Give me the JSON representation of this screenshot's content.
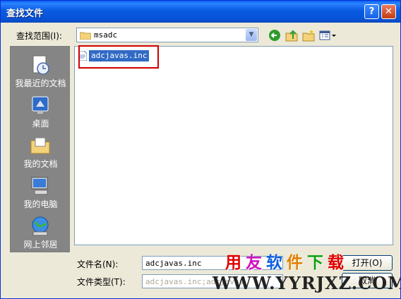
{
  "window": {
    "title": "查找文件",
    "help_label": "?",
    "close_label": "✕"
  },
  "toolbar": {
    "look_in_label": "查找范围(I):",
    "look_in_value": "msadc",
    "back_icon": "back-arrow-icon",
    "up_icon": "up-folder-icon",
    "new_folder_icon": "new-folder-icon",
    "view_icon": "view-menu-icon"
  },
  "places": [
    {
      "label": "我最近的文档",
      "icon": "recent-documents-icon"
    },
    {
      "label": "桌面",
      "icon": "desktop-icon"
    },
    {
      "label": "我的文档",
      "icon": "my-documents-icon"
    },
    {
      "label": "我的电脑",
      "icon": "my-computer-icon"
    },
    {
      "label": "网上邻居",
      "icon": "network-places-icon"
    }
  ],
  "files": [
    {
      "name": "adcjavas.inc",
      "selected": true
    }
  ],
  "bottom": {
    "filename_label": "文件名(N):",
    "filename_value": "adcjavas.inc",
    "filetype_label": "文件类型(T):",
    "filetype_value": "adcjavas.inc;adcjavas",
    "open_label": "打开(O)",
    "cancel_label": "取消"
  },
  "watermark": {
    "chars": [
      "用",
      "友",
      "软",
      "件",
      "下",
      "载"
    ],
    "colors": [
      "#e00000",
      "#d010c0",
      "#1060e0",
      "#e08000",
      "#10a010",
      "#e00000"
    ],
    "url": "WWW.YYRJXZ.COM"
  },
  "colors": {
    "title_bar": "#0a5ae0",
    "selection": "#316ac5",
    "highlight_box": "#d00000"
  }
}
